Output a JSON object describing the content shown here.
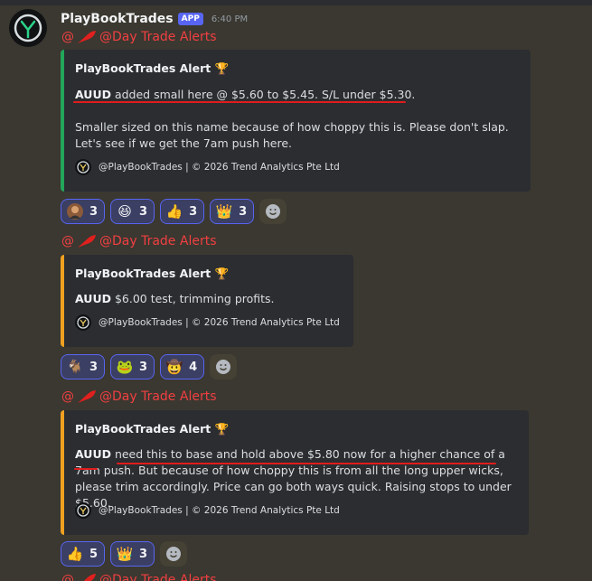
{
  "author": {
    "name": "PlayBookTrades",
    "badge": "APP",
    "timestamp": "6:40 PM"
  },
  "messages": [
    {
      "mention": "@Day Trade Alerts",
      "embed": {
        "title": "PlayBookTrades Alert",
        "ticker": "AUUD",
        "lines": [
          " added small here @ $5.60 to $5.45. S/L under $5.30.",
          "Smaller sized on this name because of how choppy this is. Please don't slap. Let's see if we get the 7am push here."
        ],
        "footer": "@PlayBookTrades | © 2026 Trend Analytics Pte Ltd"
      },
      "reactions": [
        {
          "icon": "person-avatar-emoji",
          "count": "3"
        },
        {
          "icon": "grinning-squint-emoji",
          "count": "3"
        },
        {
          "icon": "thumbs-up-emoji",
          "count": "3"
        },
        {
          "icon": "crown-emoji",
          "count": "3"
        }
      ]
    },
    {
      "mention": "@Day Trade Alerts",
      "embed": {
        "title": "PlayBookTrades Alert",
        "ticker": "AUUD",
        "lines": [
          " $6.00 test, trimming profits."
        ],
        "footer": "@PlayBookTrades | © 2026 Trend Analytics Pte Ltd"
      },
      "reactions": [
        {
          "icon": "goat-emoji",
          "count": "3"
        },
        {
          "icon": "frog-emoji",
          "count": "3"
        },
        {
          "icon": "cowboy-emoji",
          "count": "4"
        }
      ]
    },
    {
      "mention": "@Day Trade Alerts",
      "embed": {
        "title": "PlayBookTrades Alert",
        "ticker": "AUUD",
        "lines": [
          " need this to base and hold above $5.80 now for a higher chance of a 7am push. But because of how choppy this is from all the long upper wicks, please trim accordingly. Price can go both ways quick. Raising stops to under $5.60."
        ],
        "footer": "@PlayBookTrades | © 2026 Trend Analytics Pte Ltd"
      },
      "reactions": [
        {
          "icon": "thumbs-up-emoji",
          "count": "5"
        },
        {
          "icon": "crown-emoji",
          "count": "3"
        }
      ]
    }
  ],
  "colors": {
    "mention": "#f23f42",
    "embed_green": "#23a55a",
    "embed_orange": "#f0a020",
    "reaction_border": "#5865f2"
  }
}
